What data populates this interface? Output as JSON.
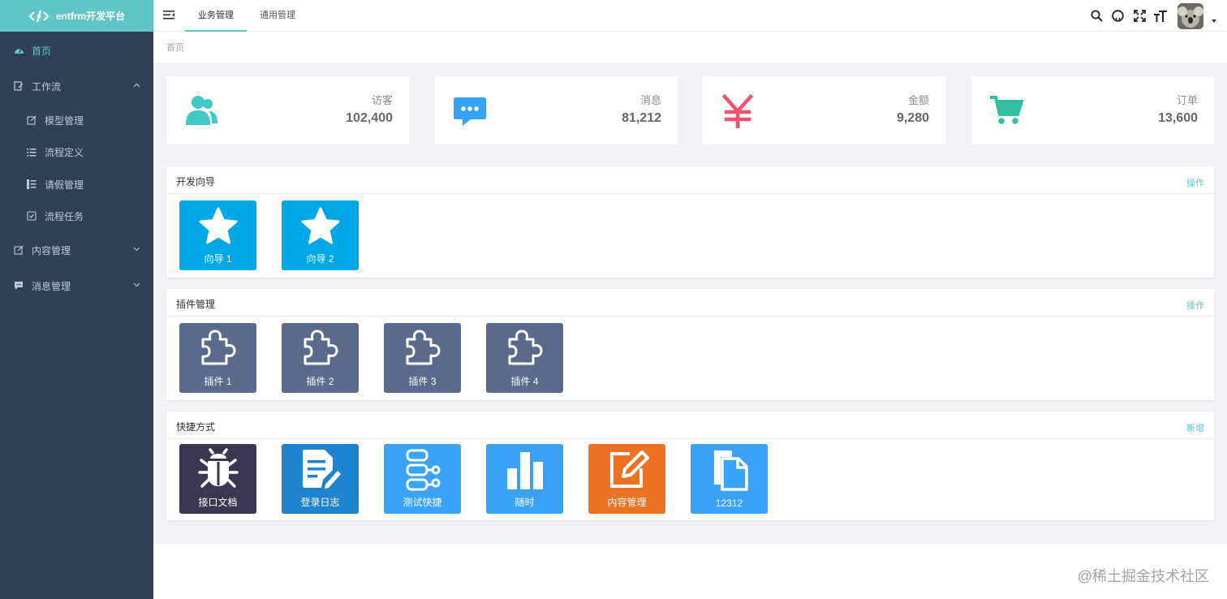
{
  "app": {
    "title": "entfrm开发平台"
  },
  "sidebar": {
    "items": [
      {
        "label": "首页",
        "icon": "dashboard-icon"
      },
      {
        "label": "工作流",
        "icon": "workflow-icon"
      },
      {
        "label": "模型管理",
        "icon": "edit-icon"
      },
      {
        "label": "流程定义",
        "icon": "list-icon"
      },
      {
        "label": "请假管理",
        "icon": "tree-list-icon"
      },
      {
        "label": "流程任务",
        "icon": "task-icon"
      },
      {
        "label": "内容管理",
        "icon": "edit-icon"
      },
      {
        "label": "消息管理",
        "icon": "message-icon"
      }
    ]
  },
  "header": {
    "tabs": [
      {
        "label": "业务管理"
      },
      {
        "label": "通用管理"
      }
    ],
    "icons": [
      "search-icon",
      "github-icon",
      "fullscreen-icon",
      "font-size-icon"
    ]
  },
  "breadcrumb": {
    "current": "首页"
  },
  "stats": [
    {
      "label": "访客",
      "value": "102,400",
      "icon": "users-icon",
      "color": "#40c9c6"
    },
    {
      "label": "消息",
      "value": "81,212",
      "icon": "message-icon",
      "color": "#36a3f7"
    },
    {
      "label": "金额",
      "value": "9,280",
      "icon": "yen-icon",
      "color": "#f4516c"
    },
    {
      "label": "订单",
      "value": "13,600",
      "icon": "cart-icon",
      "color": "#34bfa3"
    }
  ],
  "panels": {
    "guide": {
      "title": "开发向导",
      "action": "操作",
      "tiles": [
        {
          "label": "向导 1",
          "icon": "star-icon",
          "color": "#00a7e6"
        },
        {
          "label": "向导 2",
          "icon": "star-icon",
          "color": "#00a7e6"
        }
      ]
    },
    "plugins": {
      "title": "插件管理",
      "action": "操作",
      "tiles": [
        {
          "label": "插件 1",
          "icon": "puzzle-icon",
          "color": "#5a6a8c"
        },
        {
          "label": "插件 2",
          "icon": "puzzle-icon",
          "color": "#5a6a8c"
        },
        {
          "label": "插件 3",
          "icon": "puzzle-icon",
          "color": "#5a6a8c"
        },
        {
          "label": "插件 4",
          "icon": "puzzle-icon",
          "color": "#5a6a8c"
        }
      ]
    },
    "shortcuts": {
      "title": "快捷方式",
      "action": "新增",
      "tiles": [
        {
          "label": "接口文档",
          "icon": "bug-icon",
          "color": "#3b3651"
        },
        {
          "label": "登录日志",
          "icon": "document-edit-icon",
          "color": "#1e84d0"
        },
        {
          "label": "测试快捷",
          "icon": "flow-icon",
          "color": "#3aa3f5"
        },
        {
          "label": "随时",
          "icon": "bar-chart-icon",
          "color": "#3aa3f5"
        },
        {
          "label": "内容管理",
          "icon": "edit-square-icon",
          "color": "#ec7224"
        },
        {
          "label": "12312",
          "icon": "files-icon",
          "color": "#3aa3f5"
        }
      ]
    }
  },
  "watermark": "@稀土掘金技术社区"
}
